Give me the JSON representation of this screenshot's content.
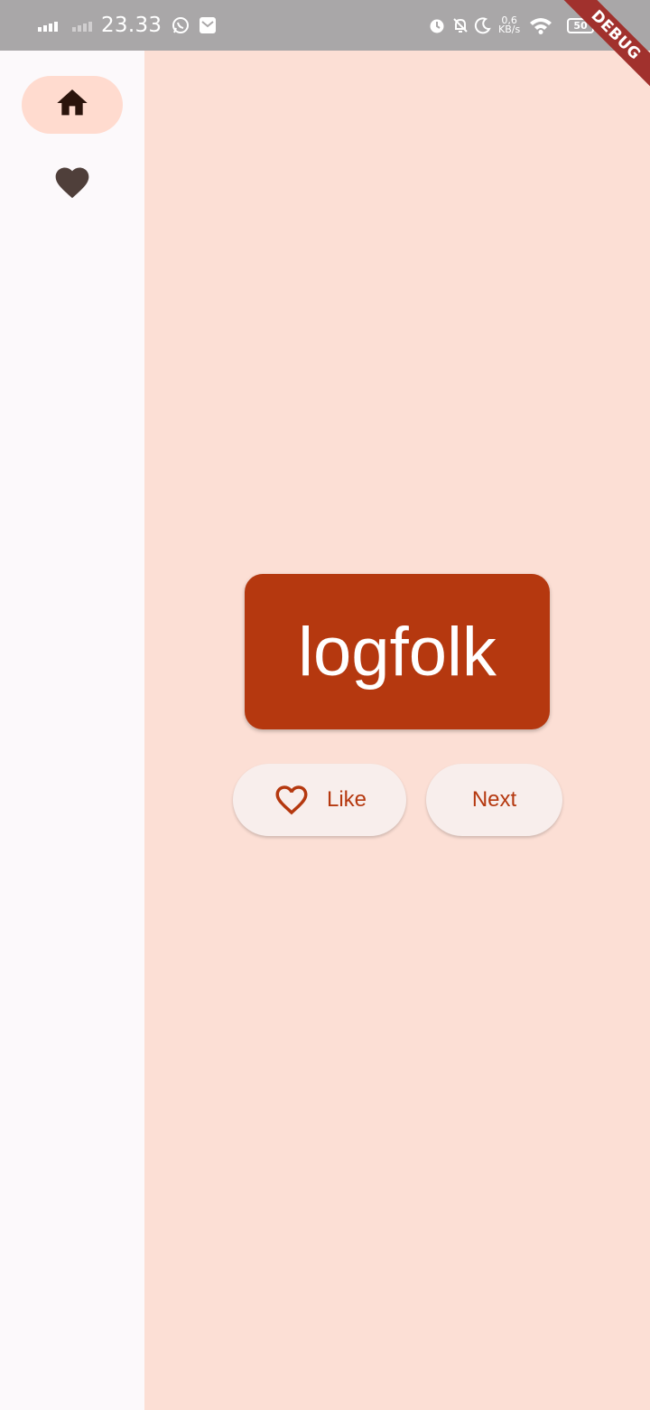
{
  "status_bar": {
    "time": "23.33",
    "net_speed_value": "0,6",
    "net_speed_unit": "KB/s",
    "battery_level": "50",
    "icons": [
      "signal-icon",
      "signal-icon",
      "whatsapp-icon",
      "mail-icon",
      "alarm-icon",
      "bell-muted-icon",
      "moon-icon",
      "wifi-icon",
      "battery-icon",
      "charging-bolt-icon"
    ]
  },
  "debug_banner": "DEBUG",
  "nav_rail": {
    "items": [
      {
        "icon": "home-icon",
        "selected": true
      },
      {
        "icon": "heart-filled-icon",
        "selected": false
      }
    ]
  },
  "main": {
    "word": "logfolk",
    "like_label": "Like",
    "next_label": "Next"
  },
  "colors": {
    "primary": "#b5380f",
    "content_background": "#fcdfd5",
    "rail_background": "#fcf9fb",
    "rail_indicator": "#ffdbcf",
    "button_background": "#f8eeec"
  }
}
